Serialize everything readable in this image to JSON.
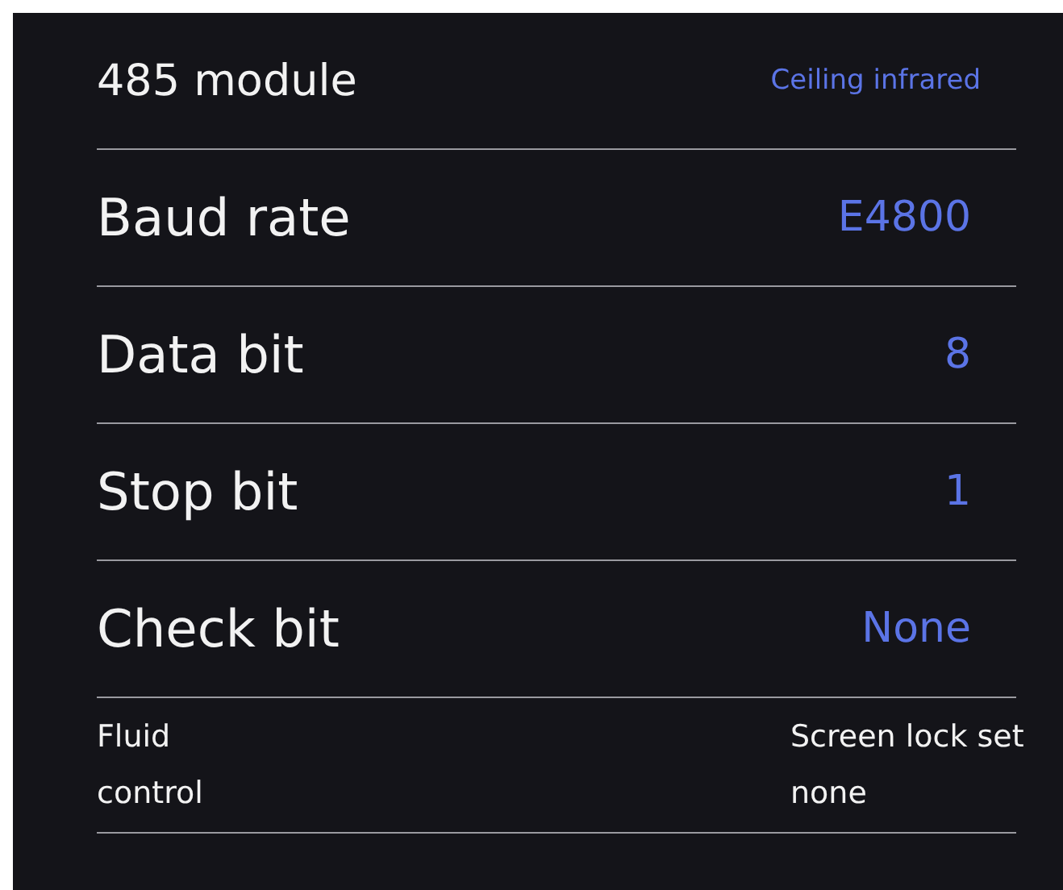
{
  "settings": [
    {
      "kind": "module",
      "label": "485 module",
      "value": "Ceiling infrared"
    },
    {
      "kind": "field",
      "label": "Baud rate",
      "value": "E4800"
    },
    {
      "kind": "field",
      "label": "Data bit",
      "value": "8"
    },
    {
      "kind": "field",
      "label": "Stop bit",
      "value": "1"
    },
    {
      "kind": "field",
      "label": "Check bit",
      "value": "None"
    },
    {
      "kind": "note",
      "label": "Fluid control",
      "value": "Screen lock set none"
    }
  ]
}
